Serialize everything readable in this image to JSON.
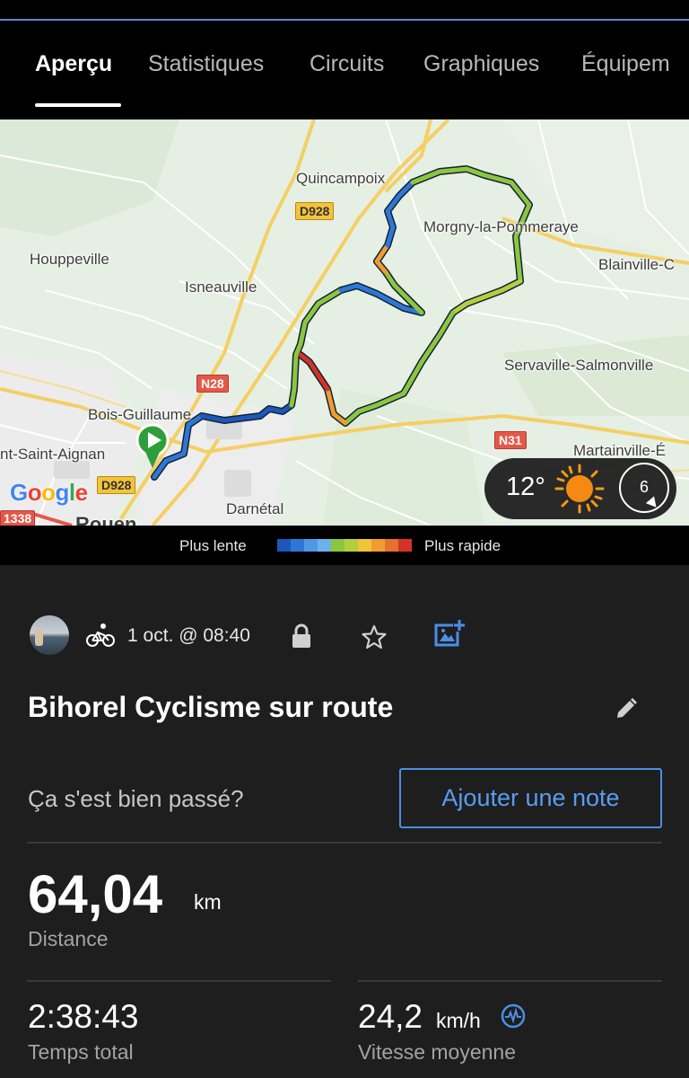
{
  "tabs": [
    {
      "label": "Aperçu",
      "active": true
    },
    {
      "label": "Statistiques"
    },
    {
      "label": "Circuits"
    },
    {
      "label": "Graphiques"
    },
    {
      "label": "Équipem"
    }
  ],
  "map": {
    "towns": {
      "quincampoix": "Quincampoix",
      "morgny": "Morgny-la-Pommeraye",
      "houppeville": "Houppeville",
      "blainville": "Blainville-C",
      "isneauville": "Isneauville",
      "servaville": "Servaville-Salmonville",
      "bois_guillaume": "Bois-Guillaume",
      "saint_aignan": "nt-Saint-Aignan",
      "martainville": "Martainville-É",
      "darnetal": "Darnétal",
      "rouen": "Rouen"
    },
    "roads": {
      "d928_top": "D928",
      "n28": "N28",
      "n31": "N31",
      "d928_bottom": "D928",
      "red_road": "1338"
    },
    "attribution": {
      "letters": [
        "G",
        "o",
        "o",
        "g",
        "l",
        "e"
      ],
      "colors": [
        "#4285f4",
        "#ea4335",
        "#fbbc05",
        "#4285f4",
        "#34a853",
        "#ea4335"
      ]
    },
    "weather": {
      "temperature": "12°",
      "wind": "6",
      "icon": "sun-icon"
    }
  },
  "speed_legend": {
    "slow_label": "Plus lente",
    "fast_label": "Plus rapide",
    "colors": [
      "#1f57b8",
      "#2f77d6",
      "#4f98e6",
      "#6cb2ea",
      "#8cc63f",
      "#b4cf3e",
      "#f0c53a",
      "#f09c33",
      "#e6702c",
      "#d6322a"
    ]
  },
  "activity": {
    "sport_icon": "bike-icon",
    "date": "1 oct. @ 08:40",
    "title": "Bihorel Cyclisme sur route",
    "question": "Ça s'est bien passé?",
    "add_note_label": "Ajouter une note",
    "distance": {
      "value": "64,04",
      "unit": "km",
      "label": "Distance"
    },
    "total_time": {
      "value": "2:38:43",
      "label": "Temps total"
    },
    "avg_speed": {
      "value": "24,2",
      "unit": "km/h",
      "label": "Vitesse moyenne"
    }
  }
}
